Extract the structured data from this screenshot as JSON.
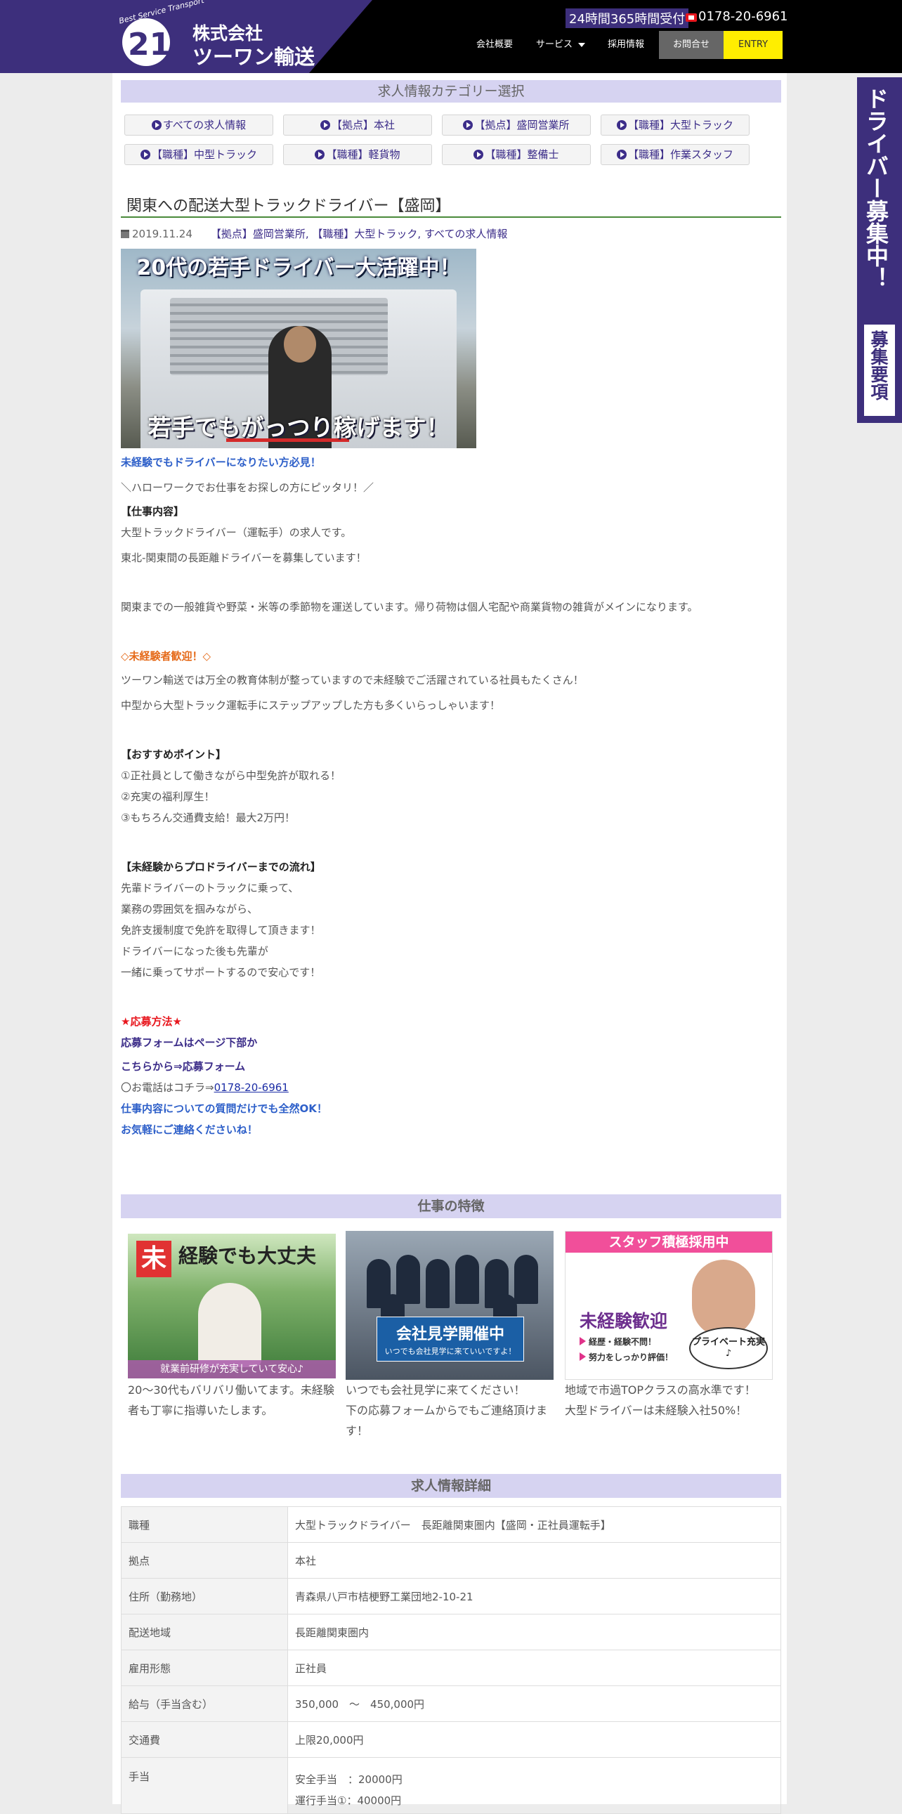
{
  "header": {
    "brand_tagline": "Best Service Transport",
    "brand_name_line1": "株式会社",
    "brand_name_line2": "ツーワン輸送",
    "hotline_badge": "24時間365時間受付",
    "phone": "0178-20-6961",
    "nav": {
      "about": "会社概要",
      "service": "サービス",
      "recruit": "採用情報",
      "contact": "お問合せ",
      "entry": "ENTRY"
    },
    "colors": {
      "brand": "#3d2f7c",
      "entry": "#ffee00",
      "contact": "#666666"
    }
  },
  "categories": {
    "heading": "求人情報カテゴリー選択",
    "items": [
      "すべての求人情報",
      "【拠点】本社",
      "【拠点】盛岡営業所",
      "【職種】大型トラック",
      "【職種】中型トラック",
      "【職種】軽貨物",
      "【職種】整備士",
      "【職種】作業スタッフ"
    ]
  },
  "post": {
    "title": "関東への配送大型トラックドライバー【盛岡】",
    "date": "2019.11.24",
    "meta_categories": "【拠点】盛岡営業所, 【職種】大型トラック, すべての求人情報",
    "hero_top_text": "20代の若手ドライバー大活躍中！",
    "hero_bottom_text": "若手でもがっつり稼げます！",
    "body": {
      "lead": "未経験でもドライバーになりたい方必見！",
      "hellowork": "＼ハローワークでお仕事をお探しの方にピッタリ！／",
      "job_heading": "【仕事内容】",
      "job_line1": "大型トラックドライバー（運転手）の求人です。",
      "job_line2": "東北-関東間の長距離ドライバーを募集しています！",
      "job_line3": "関東までの一般雑貨や野菜・米等の季節物を運送しています。帰り荷物は個人宅配や商業貨物の雑貨がメインになります。",
      "welcome_heading": "◇未経験者歓迎！◇",
      "welcome_line1": "ツーワン輸送では万全の教育体制が整っていますので未経験でご活躍されている社員もたくさん！",
      "welcome_line2": "中型から大型トラック運転手にステップアップした方も多くいらっしゃいます！",
      "points_heading": "【おすすめポイント】",
      "point1": "①正社員として働きながら中型免許が取れる！",
      "point2": "②充実の福利厚生！",
      "point3": "③もちろん交通費支給！最大2万円！",
      "flow_heading": "【未経験からプロドライバーまでの流れ】",
      "flow1": "先輩ドライバーのトラックに乗って、",
      "flow2": "業務の雰囲気を掴みながら、",
      "flow3": "免許支援制度で免許を取得して頂きます！",
      "flow4": "ドライバーになった後も先輩が",
      "flow5": "一緒に乗ってサポートするので安心です！",
      "apply_heading": "★応募方法★",
      "apply_line1": "応募フォームはページ下部か",
      "apply_line2": "こちらから⇒応募フォーム",
      "apply_phone_prefix": "〇お電話はコチラ⇒",
      "apply_phone": "0178-20-6961",
      "apply_line4": "仕事内容についての質問だけでも全然OK！",
      "apply_line5": "お気軽にご連絡くださいね！"
    }
  },
  "features": {
    "heading": "仕事の特徴",
    "card1": {
      "badge": "未",
      "title": "経験でも大丈夫",
      "caption": "就業前研修が充実していて安心♪",
      "text": "20～30代もバリバリ働いてます。未経験者も丁寧に指導いたします。"
    },
    "card2": {
      "title": "会社見学開催中",
      "sub": "いつでも会社見学に来ていいですよ！",
      "text1": "いつでも会社見学に来てください！",
      "text2": "下の応募フォームからでもご連絡頂けます！"
    },
    "card3": {
      "banner": "スタッフ積極採用中",
      "title": "未経験歓迎",
      "bullet1": "経歴・経験不問！",
      "bullet2": "努力をしっかり評価！",
      "bubble": "プライベート充実♪",
      "text1": "地域で市過TOPクラスの高水準です！",
      "text2": "大型ドライバーは未経験入社50%！"
    }
  },
  "details": {
    "heading": "求人情報詳細",
    "rows": [
      {
        "key": "職種",
        "value": "大型トラックドライバー　長距離関東圏内【盛岡・正社員運転手】"
      },
      {
        "key": "拠点",
        "value": "本社"
      },
      {
        "key": "住所（勤務地）",
        "value": "青森県八戸市桔梗野工業団地2-10-21"
      },
      {
        "key": "配送地域",
        "value": "長距離関東圏内"
      },
      {
        "key": "雇用形態",
        "value": "正社員"
      },
      {
        "key": "給与（手当含む）",
        "value": "350,000　～　450,000円"
      },
      {
        "key": "交通費",
        "value": "上限20,000円"
      },
      {
        "key": "手当",
        "value": "安全手当　：20000円",
        "value2": "運行手当①：40000円"
      }
    ]
  },
  "side_banner": {
    "text": "ドライバー募集中！",
    "button": "募集要項"
  }
}
